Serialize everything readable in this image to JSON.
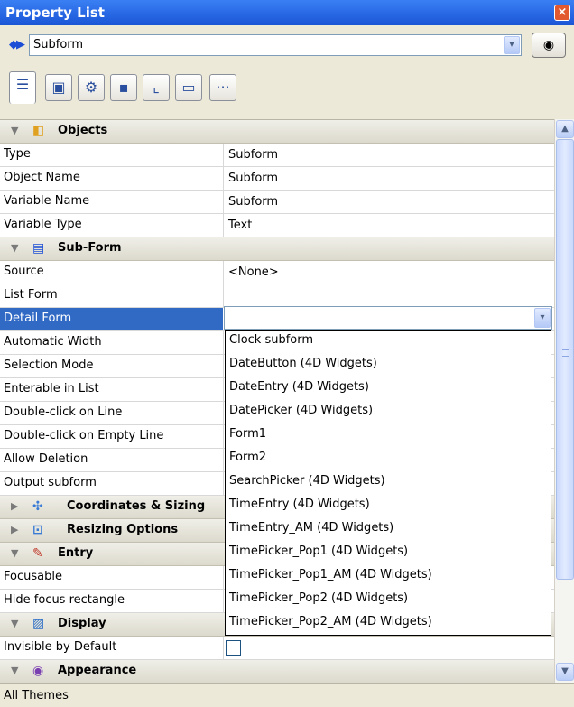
{
  "window": {
    "title": "Property List",
    "close_glyph": "×"
  },
  "selector": {
    "arrows_glyph": "◆▶",
    "value": "Subform",
    "dropdown_glyph": "▾",
    "eye_glyph": "◉"
  },
  "tabs": [
    {
      "icon": "list-icon",
      "glyph": "☰"
    },
    {
      "icon": "object-icon",
      "glyph": "▣"
    },
    {
      "icon": "gear-icon",
      "glyph": "⚙"
    },
    {
      "icon": "shapes-icon",
      "glyph": "▪"
    },
    {
      "icon": "chart-icon",
      "glyph": "⌞"
    },
    {
      "icon": "monitor-icon",
      "glyph": "▭"
    },
    {
      "icon": "more-icon",
      "glyph": "···"
    }
  ],
  "sections": {
    "objects": {
      "label": "Objects",
      "tri": "▼",
      "icon": "cube-icon",
      "glyph": "◧"
    },
    "subform": {
      "label": "Sub-Form",
      "tri": "▼",
      "icon": "subform-icon",
      "glyph": "▤"
    },
    "coordinates": {
      "label": "Coordinates & Sizing",
      "tri": "▶",
      "icon": "move-icon",
      "glyph": "✣"
    },
    "resizing": {
      "label": "Resizing Options",
      "tri": "▶",
      "icon": "resize-icon",
      "glyph": "⊡"
    },
    "entry": {
      "label": "Entry",
      "tri": "▼",
      "icon": "entry-icon",
      "glyph": "✎"
    },
    "display": {
      "label": "Display",
      "tri": "▼",
      "icon": "display-icon",
      "glyph": "▨"
    },
    "appearance": {
      "label": "Appearance",
      "tri": "▼",
      "icon": "eye-icon",
      "glyph": "◉"
    }
  },
  "objects_rows": [
    {
      "key": "Type",
      "value": "Subform"
    },
    {
      "key": "Object Name",
      "value": "Subform"
    },
    {
      "key": "Variable Name",
      "value": "Subform"
    },
    {
      "key": "Variable Type",
      "value": "Text"
    }
  ],
  "subform_rows": [
    {
      "key": "Source",
      "value": "<None>"
    },
    {
      "key": "List Form",
      "value": ""
    },
    {
      "key": "Detail Form",
      "value": ""
    },
    {
      "key": "Automatic Width",
      "value": ""
    },
    {
      "key": "Selection Mode",
      "value": ""
    },
    {
      "key": "Enterable in List",
      "value": ""
    },
    {
      "key": "Double-click on Line",
      "value": ""
    },
    {
      "key": "Double-click on Empty Line",
      "value": ""
    },
    {
      "key": "Allow Deletion",
      "value": ""
    },
    {
      "key": "Output subform",
      "value": ""
    }
  ],
  "entry_rows": [
    {
      "key": "Focusable",
      "value": ""
    },
    {
      "key": "Hide focus rectangle",
      "value": ""
    }
  ],
  "display_rows": [
    {
      "key": "Invisible by Default",
      "value": ""
    }
  ],
  "detail_form_options": [
    "Clock subform",
    "DateButton (4D Widgets)",
    "DateEntry (4D Widgets)",
    "DatePicker (4D Widgets)",
    "Form1",
    "Form2",
    "SearchPicker (4D Widgets)",
    "TimeEntry (4D Widgets)",
    "TimeEntry_AM (4D Widgets)",
    "TimePicker_Pop1 (4D Widgets)",
    "TimePicker_Pop1_AM (4D Widgets)",
    "TimePicker_Pop2 (4D Widgets)",
    "TimePicker_Pop2_AM (4D Widgets)"
  ],
  "scrollbar": {
    "up_glyph": "▲",
    "down_glyph": "▼"
  },
  "status": {
    "text": "All Themes"
  }
}
